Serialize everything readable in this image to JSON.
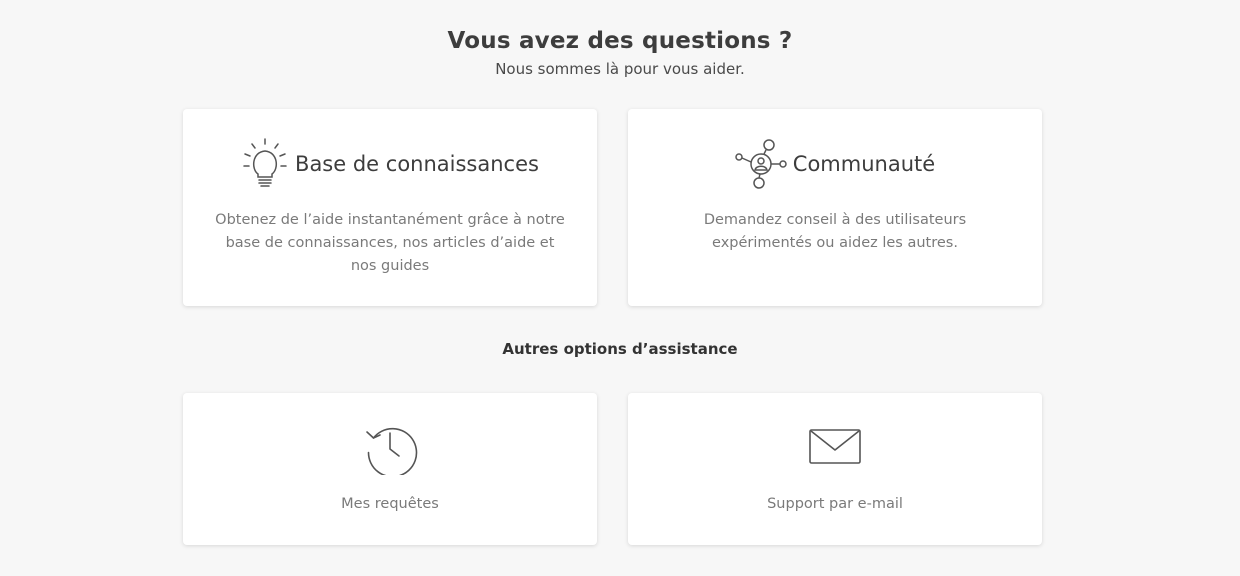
{
  "header": {
    "title": "Vous avez des questions ?",
    "subtitle": "Nous sommes là pour vous aider."
  },
  "cards": [
    {
      "title": "Base de connaissances",
      "description": "Obtenez de l’aide instantanément grâce à notre base de connaissances, nos articles d’aide et nos guides",
      "icon": "lightbulb-icon"
    },
    {
      "title": "Communauté",
      "description": "Demandez conseil à des utilisateurs expérimentés ou aidez les autres.",
      "icon": "community-network-icon"
    }
  ],
  "other_options": {
    "heading": "Autres options d’assistance",
    "items": [
      {
        "label": "Mes requêtes",
        "icon": "history-clock-icon"
      },
      {
        "label": "Support par e-mail",
        "icon": "envelope-icon"
      }
    ]
  },
  "colors": {
    "background": "#f7f7f7",
    "card": "#ffffff",
    "text": "#3d3d3d",
    "muted_text": "#7a7a7a",
    "icon_stroke": "#555555"
  }
}
